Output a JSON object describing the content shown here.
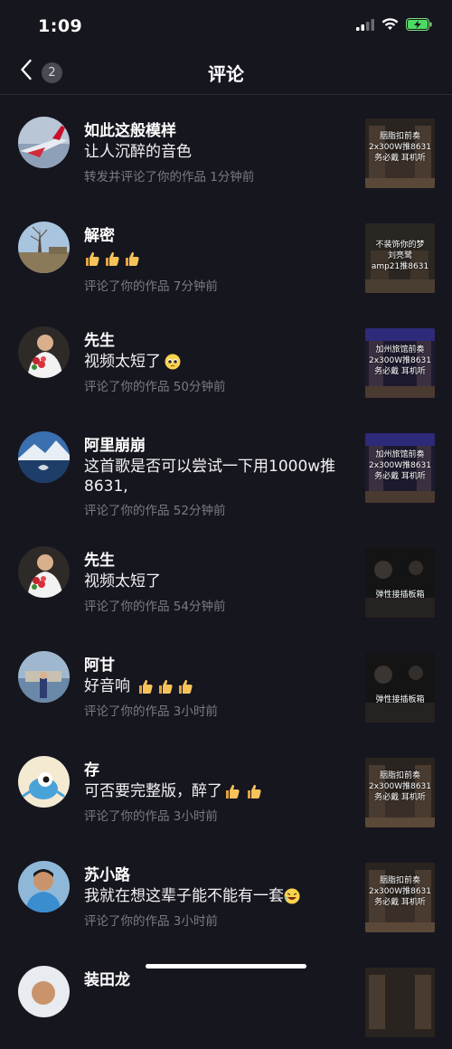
{
  "status": {
    "time": "1:09"
  },
  "header": {
    "badge_count": "2",
    "title": "评论"
  },
  "comments": [
    {
      "name": "如此这般模样",
      "text": "让人沉醉的音色",
      "meta": "转发并评论了你的作品  1分钟前",
      "thumb_text": "胭脂扣前奏\n2x300W推8631\n务必戴  耳机听",
      "emoji": ""
    },
    {
      "name": "解密",
      "text": "",
      "meta": "评论了你的作品  7分钟前",
      "thumb_text": "不装饰你的梦\n刘亮鹭\namp21推8631",
      "emoji": "thumbs3"
    },
    {
      "name": "先生",
      "text": "视频太短了",
      "meta": "评论了你的作品  50分钟前",
      "thumb_text": "加州旅馆前奏\n2x300W推8631\n务必戴  耳机听",
      "emoji": "pleading"
    },
    {
      "name": "阿里崩崩",
      "text": "这首歌是否可以尝试一下用1000w推8631,",
      "meta": "评论了你的作品  52分钟前",
      "thumb_text": "加州旅馆前奏\n2x300W推8631\n务必戴  耳机听",
      "emoji": ""
    },
    {
      "name": "先生",
      "text": "视频太短了",
      "meta": "评论了你的作品  54分钟前",
      "thumb_text": "弹性接插板箱",
      "emoji": ""
    },
    {
      "name": "阿甘",
      "text": "好音响",
      "meta": "评论了你的作品  3小时前",
      "thumb_text": "弹性接插板箱",
      "emoji": "thumbs3"
    },
    {
      "name": "存",
      "text": "可否要完整版，醉了",
      "meta": "评论了你的作品  3小时前",
      "thumb_text": "胭脂扣前奏\n2x300W推8631\n务必戴  耳机听",
      "emoji": "thumbs2"
    },
    {
      "name": "苏小路",
      "text": "我就在想这辈子能不能有一套",
      "meta": "评论了你的作品  3小时前",
      "thumb_text": "胭脂扣前奏\n2x300W推8631\n务必戴  耳机听",
      "emoji": "laugh"
    },
    {
      "name": "装田龙",
      "text": "",
      "meta": "",
      "thumb_text": "",
      "emoji": ""
    }
  ],
  "colors": {
    "background": "#16161f",
    "meta_text": "#7b7b86",
    "divider": "#2a2a34"
  }
}
